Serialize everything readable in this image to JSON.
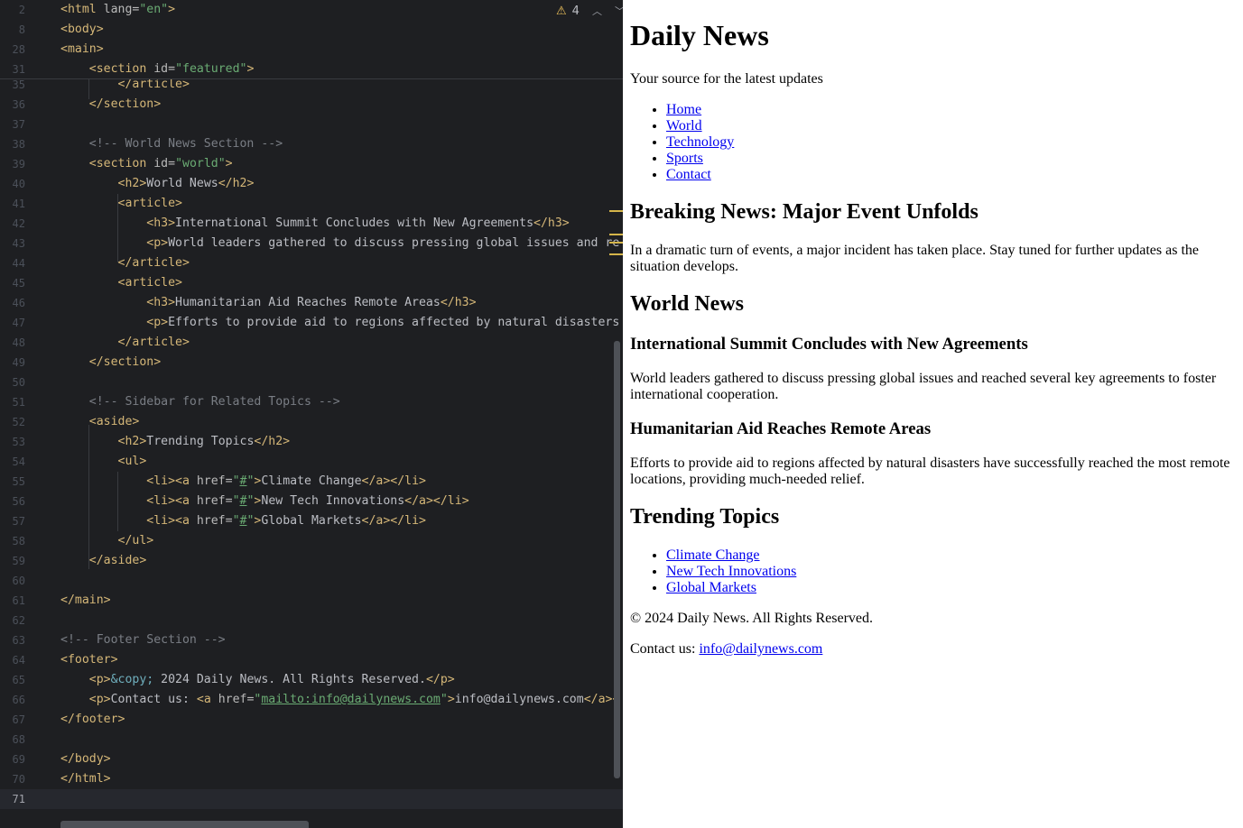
{
  "editor": {
    "inspection": {
      "warning_count": "4"
    },
    "sticky_lines": [
      {
        "num": "2",
        "tokens": [
          [
            "t",
            "<html "
          ],
          [
            "a",
            "lang="
          ],
          [
            "v",
            "\"en\""
          ],
          [
            "t",
            ">"
          ]
        ]
      },
      {
        "num": "8",
        "tokens": [
          [
            "t",
            "<body>"
          ]
        ]
      },
      {
        "num": "28",
        "tokens": [
          [
            "t",
            "<main>"
          ]
        ]
      },
      {
        "num": "31",
        "tokens": [
          [
            "p",
            "    "
          ],
          [
            "t",
            "<section "
          ],
          [
            "a",
            "id="
          ],
          [
            "v",
            "\"featured\""
          ],
          [
            "t",
            ">"
          ]
        ]
      }
    ],
    "lines": [
      {
        "num": "35",
        "tokens": [
          [
            "p",
            "        "
          ],
          [
            "t",
            "</article>"
          ]
        ]
      },
      {
        "num": "36",
        "tokens": [
          [
            "p",
            "    "
          ],
          [
            "t",
            "</section>"
          ]
        ]
      },
      {
        "num": "37",
        "tokens": []
      },
      {
        "num": "38",
        "tokens": [
          [
            "p",
            "    "
          ],
          [
            "cm",
            "<!-- World News Section -->"
          ]
        ]
      },
      {
        "num": "39",
        "tokens": [
          [
            "p",
            "    "
          ],
          [
            "t",
            "<section "
          ],
          [
            "a",
            "id="
          ],
          [
            "v",
            "\"world\""
          ],
          [
            "t",
            ">"
          ]
        ]
      },
      {
        "num": "40",
        "tokens": [
          [
            "p",
            "        "
          ],
          [
            "t",
            "<h2>"
          ],
          [
            "p",
            "World News"
          ],
          [
            "t",
            "</h2>"
          ]
        ]
      },
      {
        "num": "41",
        "tokens": [
          [
            "p",
            "        "
          ],
          [
            "t",
            "<article>"
          ]
        ]
      },
      {
        "num": "42",
        "tokens": [
          [
            "p",
            "            "
          ],
          [
            "t",
            "<h3>"
          ],
          [
            "p",
            "International Summit Concludes with New Agreements"
          ],
          [
            "t",
            "</h3>"
          ]
        ]
      },
      {
        "num": "43",
        "tokens": [
          [
            "p",
            "            "
          ],
          [
            "t",
            "<p>"
          ],
          [
            "p",
            "World leaders gathered to discuss pressing global issues and re"
          ]
        ]
      },
      {
        "num": "44",
        "tokens": [
          [
            "p",
            "        "
          ],
          [
            "t",
            "</article>"
          ]
        ]
      },
      {
        "num": "45",
        "tokens": [
          [
            "p",
            "        "
          ],
          [
            "t",
            "<article>"
          ]
        ]
      },
      {
        "num": "46",
        "tokens": [
          [
            "p",
            "            "
          ],
          [
            "t",
            "<h3>"
          ],
          [
            "p",
            "Humanitarian Aid Reaches Remote Areas"
          ],
          [
            "t",
            "</h3>"
          ]
        ]
      },
      {
        "num": "47",
        "tokens": [
          [
            "p",
            "            "
          ],
          [
            "t",
            "<p>"
          ],
          [
            "p",
            "Efforts to provide aid to regions affected by natural disasters"
          ]
        ]
      },
      {
        "num": "48",
        "tokens": [
          [
            "p",
            "        "
          ],
          [
            "t",
            "</article>"
          ]
        ]
      },
      {
        "num": "49",
        "tokens": [
          [
            "p",
            "    "
          ],
          [
            "t",
            "</section>"
          ]
        ]
      },
      {
        "num": "50",
        "tokens": []
      },
      {
        "num": "51",
        "tokens": [
          [
            "p",
            "    "
          ],
          [
            "cm",
            "<!-- Sidebar for Related Topics -->"
          ]
        ]
      },
      {
        "num": "52",
        "tokens": [
          [
            "p",
            "    "
          ],
          [
            "t",
            "<aside>"
          ]
        ]
      },
      {
        "num": "53",
        "tokens": [
          [
            "p",
            "        "
          ],
          [
            "t",
            "<h2>"
          ],
          [
            "p",
            "Trending Topics"
          ],
          [
            "t",
            "</h2>"
          ]
        ]
      },
      {
        "num": "54",
        "tokens": [
          [
            "p",
            "        "
          ],
          [
            "t",
            "<ul>"
          ]
        ]
      },
      {
        "num": "55",
        "tokens": [
          [
            "p",
            "            "
          ],
          [
            "t",
            "<li><a "
          ],
          [
            "a",
            "href="
          ],
          [
            "v",
            "\""
          ],
          [
            "vu",
            "#"
          ],
          [
            "v",
            "\""
          ],
          [
            "t",
            ">"
          ],
          [
            "p",
            "Climate Change"
          ],
          [
            "t",
            "</a></li>"
          ]
        ]
      },
      {
        "num": "56",
        "tokens": [
          [
            "p",
            "            "
          ],
          [
            "t",
            "<li><a "
          ],
          [
            "a",
            "href="
          ],
          [
            "v",
            "\""
          ],
          [
            "vu",
            "#"
          ],
          [
            "v",
            "\""
          ],
          [
            "t",
            ">"
          ],
          [
            "p",
            "New Tech Innovations"
          ],
          [
            "t",
            "</a></li>"
          ]
        ]
      },
      {
        "num": "57",
        "tokens": [
          [
            "p",
            "            "
          ],
          [
            "t",
            "<li><a "
          ],
          [
            "a",
            "href="
          ],
          [
            "v",
            "\""
          ],
          [
            "vu",
            "#"
          ],
          [
            "v",
            "\""
          ],
          [
            "t",
            ">"
          ],
          [
            "p",
            "Global Markets"
          ],
          [
            "t",
            "</a></li>"
          ]
        ]
      },
      {
        "num": "58",
        "tokens": [
          [
            "p",
            "        "
          ],
          [
            "t",
            "</ul>"
          ]
        ]
      },
      {
        "num": "59",
        "tokens": [
          [
            "p",
            "    "
          ],
          [
            "t",
            "</aside>"
          ]
        ]
      },
      {
        "num": "60",
        "tokens": []
      },
      {
        "num": "61",
        "tokens": [
          [
            "t",
            "</main>"
          ]
        ]
      },
      {
        "num": "62",
        "tokens": []
      },
      {
        "num": "63",
        "tokens": [
          [
            "cm",
            "<!-- Footer Section -->"
          ]
        ]
      },
      {
        "num": "64",
        "tokens": [
          [
            "t",
            "<footer>"
          ]
        ]
      },
      {
        "num": "65",
        "tokens": [
          [
            "p",
            "    "
          ],
          [
            "t",
            "<p>"
          ],
          [
            "e",
            "&copy;"
          ],
          [
            "p",
            " 2024 Daily News. All Rights Reserved."
          ],
          [
            "t",
            "</p>"
          ]
        ]
      },
      {
        "num": "66",
        "tokens": [
          [
            "p",
            "    "
          ],
          [
            "t",
            "<p>"
          ],
          [
            "p",
            "Contact us: "
          ],
          [
            "t",
            "<a "
          ],
          [
            "a",
            "href="
          ],
          [
            "v",
            "\""
          ],
          [
            "vu",
            "mailto:info@dailynews.com"
          ],
          [
            "v",
            "\""
          ],
          [
            "t",
            ">"
          ],
          [
            "p",
            "info@dailynews.com"
          ],
          [
            "t",
            "</a><"
          ]
        ]
      },
      {
        "num": "67",
        "tokens": [
          [
            "t",
            "</footer>"
          ]
        ]
      },
      {
        "num": "68",
        "tokens": []
      },
      {
        "num": "69",
        "tokens": [
          [
            "t",
            "</body>"
          ]
        ]
      },
      {
        "num": "70",
        "tokens": [
          [
            "t",
            "</html>"
          ]
        ]
      },
      {
        "num": "71",
        "tokens": [],
        "current": true
      }
    ]
  },
  "preview": {
    "site_title": "Daily News",
    "tagline": "Your source for the latest updates",
    "nav": [
      "Home",
      "World",
      "Technology",
      "Sports",
      "Contact"
    ],
    "featured": {
      "title": "Breaking News: Major Event Unfolds",
      "text": "In a dramatic turn of events, a major incident has taken place. Stay tuned for further updates as the situation develops."
    },
    "world": {
      "title": "World News",
      "articles": [
        {
          "title": "International Summit Concludes with New Agreements",
          "text": "World leaders gathered to discuss pressing global issues and reached several key agreements to foster international cooperation."
        },
        {
          "title": "Humanitarian Aid Reaches Remote Areas",
          "text": "Efforts to provide aid to regions affected by natural disasters have successfully reached the most remote locations, providing much-needed relief."
        }
      ]
    },
    "trending": {
      "title": "Trending Topics",
      "items": [
        "Climate Change",
        "New Tech Innovations",
        "Global Markets"
      ]
    },
    "footer": {
      "copyright": "© 2024 Daily News. All Rights Reserved.",
      "contact_prefix": "Contact us: ",
      "email": "info@dailynews.com"
    }
  }
}
